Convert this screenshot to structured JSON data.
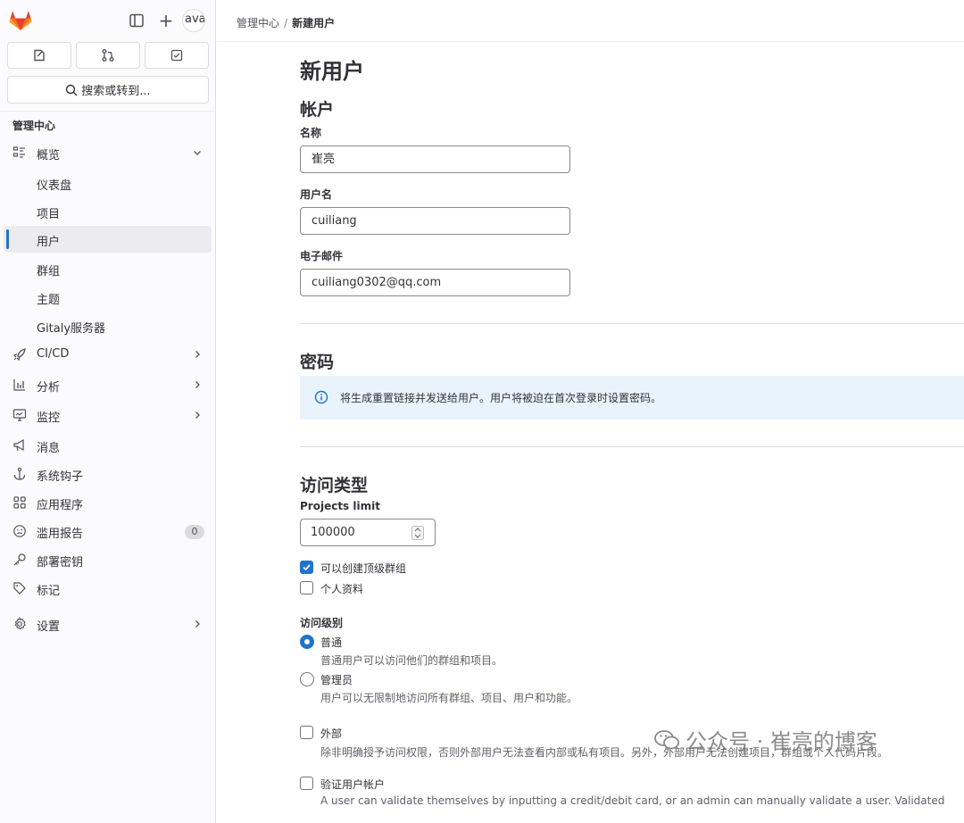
{
  "sidebar": {
    "avatar_text": "ava",
    "plus_label": "+",
    "search_label": "搜索或转到...",
    "section_title": "管理中心",
    "items": [
      {
        "label": "概览",
        "icon": "overview-icon"
      },
      {
        "label": "仪表盘"
      },
      {
        "label": "项目"
      },
      {
        "label": "用户"
      },
      {
        "label": "群组"
      },
      {
        "label": "主题"
      },
      {
        "label": "Gitaly服务器"
      },
      {
        "label": "CI/CD",
        "icon": "rocket-icon"
      },
      {
        "label": "分析",
        "icon": "chart-icon"
      },
      {
        "label": "监控",
        "icon": "monitor-icon"
      },
      {
        "label": "消息",
        "icon": "bullhorn-icon"
      },
      {
        "label": "系统钩子",
        "icon": "anchor-icon"
      },
      {
        "label": "应用程序",
        "icon": "applications-icon"
      },
      {
        "label": "滥用报告",
        "icon": "abuse-icon",
        "badge": "0"
      },
      {
        "label": "部署密钥",
        "icon": "key-icon"
      },
      {
        "label": "标记",
        "icon": "label-icon"
      },
      {
        "label": "设置",
        "icon": "settings-icon"
      }
    ]
  },
  "breadcrumb": {
    "parent": "管理中心",
    "separator": "/",
    "current": "新建用户"
  },
  "page": {
    "title": "新用户",
    "account": {
      "heading": "帐户",
      "name_label": "名称",
      "name_value": "崔亮",
      "username_label": "用户名",
      "username_value": "cuiliang",
      "email_label": "电子邮件",
      "email_value": "cuiliang0302@qq.com"
    },
    "password": {
      "heading": "密码",
      "alert": "将生成重置链接并发送给用户。用户将被迫在首次登录时设置密码。"
    },
    "access": {
      "heading": "访问类型",
      "projects_limit_label": "Projects limit",
      "projects_limit_value": "100000",
      "can_create_group_label": "可以创建顶级群组",
      "can_create_group_checked": true,
      "private_profile_label": "个人资料",
      "private_profile_checked": false,
      "access_level_label": "访问级别",
      "regular_label": "普通",
      "regular_help": "普通用户可以访问他们的群组和项目。",
      "admin_label": "管理员",
      "admin_help": "用户可以无限制地访问所有群组、项目、用户和功能。",
      "selected_level": "普通",
      "external_label": "外部",
      "external_help": "除非明确授予访问权限，否则外部用户无法查看内部或私有项目。另外，外部用户无法创建项目，群组或个人代码片段。",
      "validate_label": "验证用户帐户",
      "validate_help": "A user can validate themselves by inputting a credit/debit card, or an admin can manually validate a user. Validated"
    }
  },
  "watermark": "公众号 · 崔亮的博客",
  "colors": {
    "accent": "#1f75cb",
    "alert_bg": "#e9f3fc",
    "sidebar_bg": "#fbfafd",
    "gitlab_orange": "#e24329"
  }
}
